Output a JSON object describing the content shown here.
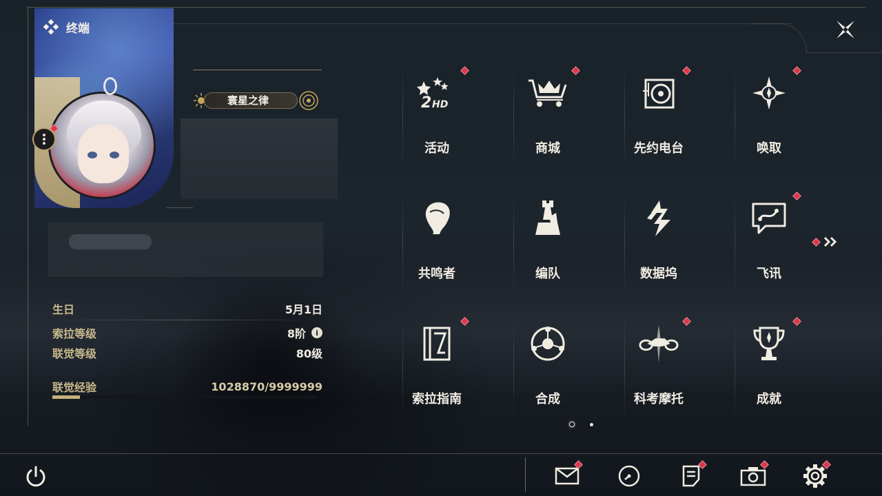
{
  "window": {
    "title": "终端",
    "close_icon": "close-icon"
  },
  "profile": {
    "title_badge": "寰星之律",
    "avatar_icon": "avatar-portrait",
    "has_notification": true
  },
  "stats": {
    "birthday_label": "生日",
    "birthday_value": "5月1日",
    "sola_level_label": "索拉等级",
    "sola_level_value": "8阶",
    "union_level_label": "联觉等级",
    "union_level_value": "80级",
    "union_exp_label": "联觉经验",
    "union_exp_value": "1028870/9999999",
    "union_exp_progress": 0.1029
  },
  "menu": {
    "items": [
      {
        "label": "活动",
        "icon": "events-2hd-icon",
        "badge": true
      },
      {
        "label": "商城",
        "icon": "shop-crown-cart-icon",
        "badge": true
      },
      {
        "label": "先约电台",
        "icon": "radio-turntable-icon",
        "badge": true
      },
      {
        "label": "唤取",
        "icon": "compass-star-icon",
        "badge": true
      },
      {
        "label": "共鸣者",
        "icon": "resonator-head-icon",
        "badge": false
      },
      {
        "label": "编队",
        "icon": "chess-pieces-icon",
        "badge": false
      },
      {
        "label": "数据坞",
        "icon": "data-dock-icon",
        "badge": false
      },
      {
        "label": "飞讯",
        "icon": "chat-bubble-icon",
        "badge": true
      },
      {
        "label": "索拉指南",
        "icon": "guidebook-icon",
        "badge": true
      },
      {
        "label": "合成",
        "icon": "synthesis-ring-icon",
        "badge": false
      },
      {
        "label": "科考摩托",
        "icon": "motorbike-icon",
        "badge": true
      },
      {
        "label": "成就",
        "icon": "trophy-icon",
        "badge": true
      }
    ],
    "next_page_icon": "double-chevron-right-icon",
    "pager": {
      "current": 1,
      "total": 2
    }
  },
  "bottom_bar": {
    "power_icon": "power-icon",
    "buttons": [
      {
        "icon": "mail-icon",
        "badge": true
      },
      {
        "icon": "clock-icon",
        "badge": false
      },
      {
        "icon": "notice-icon",
        "badge": true
      },
      {
        "icon": "camera-icon",
        "badge": true
      },
      {
        "icon": "settings-gear-icon",
        "badge": true
      }
    ]
  },
  "colors": {
    "accent_gold": "#c9b98c",
    "badge_red": "#d8394c",
    "text_light": "#f1ece2"
  }
}
